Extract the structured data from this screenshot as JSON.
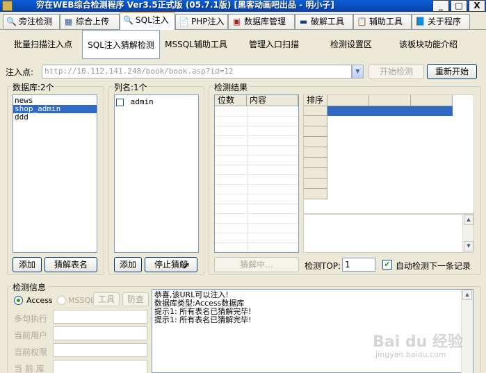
{
  "window": {
    "title": "穷在WEB综合检测程序 Ver3.5正式版 (05.7.1版) [黑客动画吧出品 - 明小子]",
    "min": "_",
    "max": "□",
    "close": "X"
  },
  "top_tabs": [
    {
      "label": "旁注检测",
      "icon": "🔍"
    },
    {
      "label": "综合上传",
      "icon": "▦"
    },
    {
      "label": "SQL注入",
      "icon": "🔍"
    },
    {
      "label": "PHP注入",
      "icon": "📄"
    },
    {
      "label": "数据库管理",
      "icon": "▣"
    },
    {
      "label": "破解工具",
      "icon": "▬"
    },
    {
      "label": "辅助工具",
      "icon": "📋"
    },
    {
      "label": "关于程序",
      "icon": "📘"
    }
  ],
  "sub_tabs": [
    {
      "label": "批量扫描注入点"
    },
    {
      "label": "SQL注入猜解检测"
    },
    {
      "label": "MSSQL辅助工具"
    },
    {
      "label": "管理入口扫描"
    },
    {
      "label": "检测设置区"
    },
    {
      "label": "该板块功能介绍"
    }
  ],
  "injection": {
    "label": "注入点:",
    "url": "http://10.112.141.248/book/book.asp?id=12",
    "start_btn": "开始检测",
    "restart_btn": "重新开始"
  },
  "database": {
    "label": "数据库:2个",
    "items": [
      "news",
      "shop_admin",
      "ddd"
    ],
    "selected": 1,
    "add_btn": "添加",
    "guess_btn": "猜解表名"
  },
  "columns": {
    "label": "列名:1个",
    "items": [
      "admin"
    ],
    "add_btn": "添加",
    "stop_btn": "停止猜解"
  },
  "results": {
    "label": "检测结果",
    "col_pos": "位数",
    "col_content": "内容",
    "sort_label": "排序",
    "decoding_btn": "猜解中..."
  },
  "detect_top": {
    "label": "检测TOP:",
    "value": "1",
    "auto_label": "自动检测下一条记录"
  },
  "detect_info": {
    "label": "检测信息",
    "access": "Access",
    "mssql": "MSSQL",
    "btn_tool": "工具",
    "btn_tree": "防查",
    "fields": [
      "多句执行",
      "当前用户",
      "当前权限",
      "当 前 库"
    ]
  },
  "log": {
    "lines": [
      "恭喜,该URL可以注入!",
      "数据库类型:Access数据库",
      "提示1: 所有表名已猜解完毕!",
      "提示1: 所有表名已猜解完毕!"
    ]
  },
  "watermark": {
    "brand": "Bai du 经验",
    "url": "jingyan.baidu.com"
  },
  "colors": {
    "titlebar": "#0842a6",
    "selection": "#316ac5",
    "active_tab_top": "#f7b64a"
  }
}
